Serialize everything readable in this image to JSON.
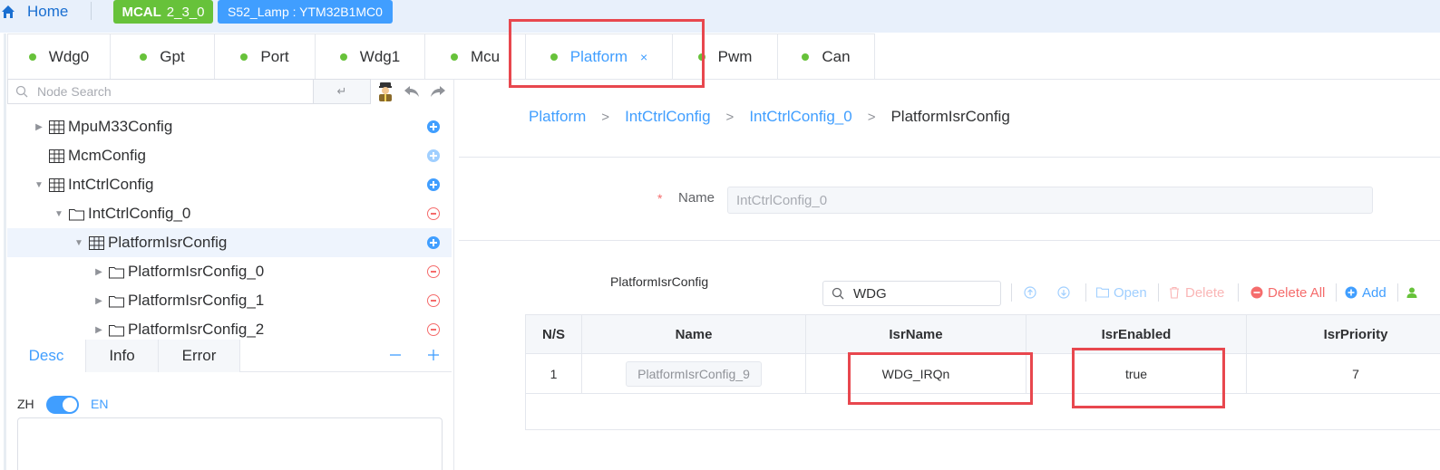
{
  "header": {
    "home_label": "Home",
    "mcal_tag_name": "MCAL",
    "mcal_tag_version": "2_3_0",
    "project_tag": "S52_Lamp : YTM32B1MC0"
  },
  "tabs": [
    {
      "label": "Wdg0"
    },
    {
      "label": "Gpt"
    },
    {
      "label": "Port"
    },
    {
      "label": "Wdg1"
    },
    {
      "label": "Mcu"
    },
    {
      "label": "Platform",
      "close": "×"
    },
    {
      "label": "Pwm"
    },
    {
      "label": "Can"
    }
  ],
  "node_search": {
    "placeholder": "Node Search",
    "enter_symbol": "↵"
  },
  "tree": [
    {
      "label": "MpuM33Config"
    },
    {
      "label": "McmConfig"
    },
    {
      "label": "IntCtrlConfig"
    },
    {
      "label": "IntCtrlConfig_0"
    },
    {
      "label": "PlatformIsrConfig"
    },
    {
      "label": "PlatformIsrConfig_0"
    },
    {
      "label": "PlatformIsrConfig_1"
    },
    {
      "label": "PlatformIsrConfig_2"
    }
  ],
  "bottom_tabs": [
    "Desc",
    "Info",
    "Error"
  ],
  "lang_toggle": {
    "left": "ZH",
    "right": "EN"
  },
  "breadcrumb": [
    "Platform",
    "IntCtrlConfig",
    "IntCtrlConfig_0",
    "PlatformIsrConfig"
  ],
  "breadcrumb_sep": ">",
  "form": {
    "required_mark": "*",
    "name_label": "Name",
    "name_value": "IntCtrlConfig_0"
  },
  "section": {
    "title": "PlatformIsrConfig"
  },
  "table_toolbar": {
    "search_value": "WDG",
    "open_label": "Open",
    "delete_label": "Delete",
    "delete_all_label": "Delete All",
    "add_label": "Add"
  },
  "table": {
    "columns": [
      "N/S",
      "Name",
      "IsrName",
      "IsrEnabled",
      "IsrPriority"
    ],
    "rows": [
      {
        "ns": "1",
        "name": "PlatformIsrConfig_9",
        "isr_name": "WDG_IRQn",
        "isr_enabled": "true",
        "isr_priority": "7"
      }
    ]
  },
  "colors": {
    "accent": "#409eff",
    "success": "#67c23a",
    "danger": "#f56c6c",
    "highlight": "#e8474e"
  }
}
